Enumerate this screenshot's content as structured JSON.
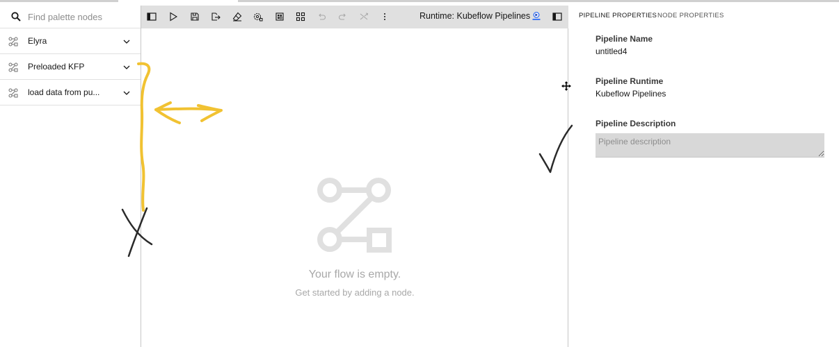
{
  "palette": {
    "search_placeholder": "Find palette nodes",
    "categories": [
      {
        "label": "Elyra",
        "icon": "pipeline-node-icon",
        "chevron": "chevron-down-icon"
      },
      {
        "label": "Preloaded KFP",
        "icon": "pipeline-node-icon",
        "chevron": "chevron-down-icon"
      },
      {
        "label": "load data from pu...",
        "icon": "pipeline-node-icon",
        "chevron": "chevron-down-icon"
      }
    ]
  },
  "toolbar": {
    "buttons": [
      "open-panel-icon",
      "run-pipeline-icon",
      "save-pipeline-icon",
      "export-pipeline-icon",
      "clear-pipeline-icon",
      "open-runtimes-icon",
      "open-runtime-images-icon",
      "open-component-catalogs-icon",
      "undo-icon",
      "redo-icon",
      "cut-icon",
      "more-options-icon"
    ],
    "runtime_label": "Runtime: Kubeflow Pipelines",
    "runtime_logo": "kubeflow-logo-icon",
    "right_button": "toggle-properties-panel-icon"
  },
  "canvas": {
    "empty_title": "Your flow is empty.",
    "empty_subtitle": "Get started by adding a node.",
    "empty_icon": "empty-flow-icon"
  },
  "properties": {
    "tabs": [
      {
        "label": "PIPELINE PROPERTIES",
        "active": true
      },
      {
        "label": "NODE PROPERTIES",
        "active": false
      }
    ],
    "pipeline_name_label": "Pipeline Name",
    "pipeline_name_value": "untitled4",
    "pipeline_runtime_label": "Pipeline Runtime",
    "pipeline_runtime_value": "Kubeflow Pipelines",
    "pipeline_description_label": "Pipeline Description",
    "pipeline_description_placeholder": "Pipeline description",
    "pipeline_description_value": ""
  },
  "annotations": {
    "yellow_brace": "resize-marker",
    "yellow_arrow": "double-arrow",
    "black_x": "cross-mark",
    "black_check": "check-mark",
    "cursor": "move-cursor-icon"
  },
  "colors": {
    "toolbar_bg": "#e0e0e0",
    "annotation_yellow": "#f1c232",
    "annotation_black": "#2a2a2a",
    "description_bg": "#d8d8d8"
  }
}
